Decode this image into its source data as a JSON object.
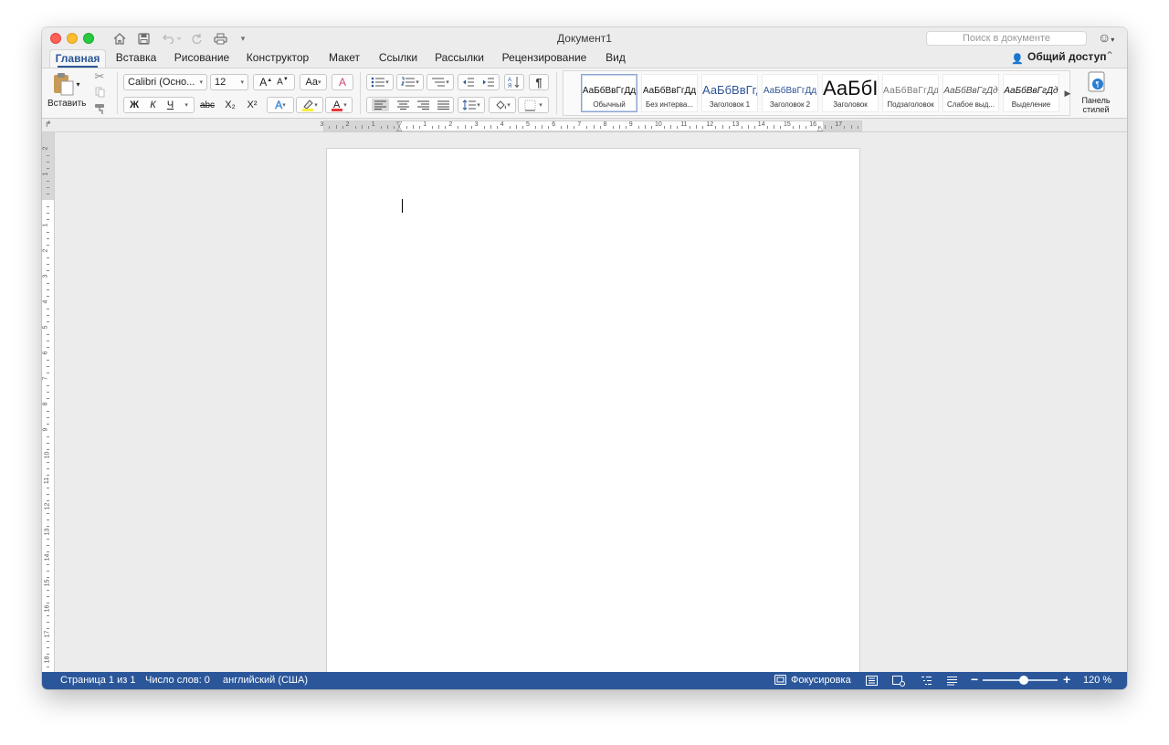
{
  "window": {
    "title": "Документ1",
    "search_placeholder": "Поиск в документе"
  },
  "tabs": [
    {
      "label": "Главная",
      "active": true
    },
    {
      "label": "Вставка",
      "active": false
    },
    {
      "label": "Рисование",
      "active": false
    },
    {
      "label": "Конструктор",
      "active": false
    },
    {
      "label": "Макет",
      "active": false
    },
    {
      "label": "Ссылки",
      "active": false
    },
    {
      "label": "Рассылки",
      "active": false
    },
    {
      "label": "Рецензирование",
      "active": false
    },
    {
      "label": "Вид",
      "active": false
    }
  ],
  "share_label": "Общий доступ",
  "ribbon": {
    "paste_label": "Вставить",
    "font_name": "Calibri (Осно...",
    "font_size": "12",
    "bold": "Ж",
    "italic": "К",
    "underline": "Ч",
    "strikethrough": "abc",
    "subscript": "X₂",
    "superscript": "X²",
    "styles": [
      {
        "sample": "АаБбВвГгДд",
        "name": "Обычный",
        "selected": true
      },
      {
        "sample": "АаБбВвГгДд",
        "name": "Без интерва...",
        "selected": false
      },
      {
        "sample": "АаБбВвГг,",
        "name": "Заголовок 1",
        "selected": false
      },
      {
        "sample": "АаБбВвГгДд",
        "name": "Заголовок 2",
        "selected": false
      },
      {
        "sample": "АаБбІ",
        "name": "Заголовок",
        "selected": false
      },
      {
        "sample": "АаБбВвГгДд",
        "name": "Подзаголовок",
        "selected": false
      },
      {
        "sample": "АаБбВвГгДд",
        "name": "Слабое выд...",
        "selected": false
      },
      {
        "sample": "АаБбВвГгДд",
        "name": "Выделение",
        "selected": false
      }
    ],
    "styles_pane_label_1": "Панель",
    "styles_pane_label_2": "стилей"
  },
  "ruler": {
    "numbers": [
      "3",
      "2",
      "1",
      "1",
      "2",
      "3",
      "4",
      "5",
      "6",
      "7",
      "8",
      "9",
      "10",
      "11",
      "12",
      "13",
      "14",
      "15",
      "16",
      "17"
    ],
    "v_numbers": [
      "2",
      "1",
      "1",
      "2",
      "3",
      "4",
      "5",
      "6",
      "7",
      "8",
      "9",
      "10",
      "11",
      "12",
      "13",
      "14",
      "15",
      "16",
      "17",
      "18"
    ]
  },
  "status": {
    "page": "Страница 1 из 1",
    "words": "Число слов: 0",
    "language": "английский (США)",
    "focus": "Фокусировка",
    "zoom": "120 %",
    "zoom_level_fraction": 0.55
  },
  "colors": {
    "accent": "#2b579a",
    "highlight": "#ffeb3b",
    "font_color": "#e53935"
  }
}
